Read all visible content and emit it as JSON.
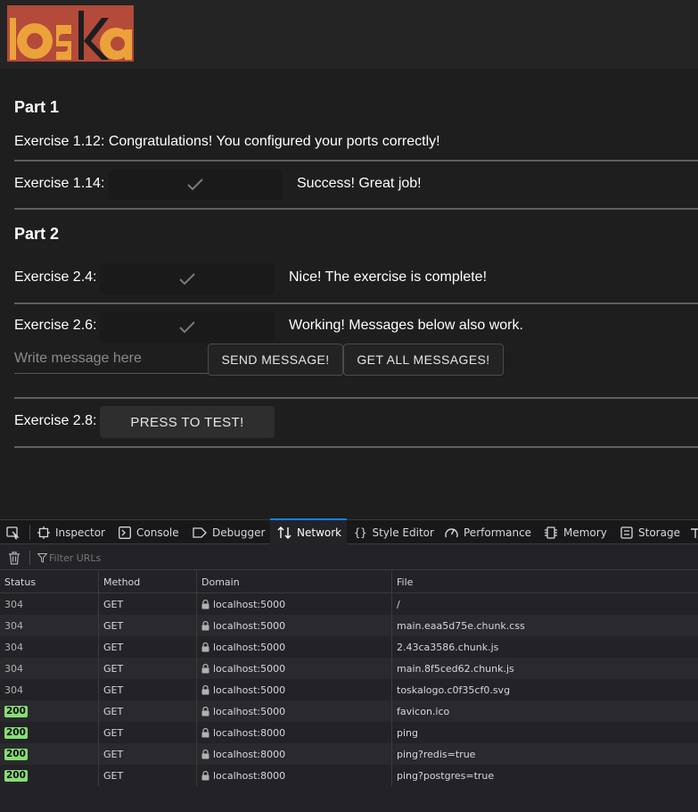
{
  "colors": {
    "app_bg": "#1e1e1e",
    "logo_red": "#b44a3a",
    "logo_orange": "#eca23a",
    "devtools_accent": "#0a84ff",
    "status_ok_bg": "#86de74"
  },
  "logo": {
    "text": "toska"
  },
  "part1": {
    "heading": "Part 1",
    "ex112": {
      "text": "Exercise 1.12: Congratulations! You configured your ports correctly!"
    },
    "ex114": {
      "label": "Exercise 1.14:",
      "message": "Success! Great job!",
      "button_icon": "checkmark-icon"
    }
  },
  "part2": {
    "heading": "Part 2",
    "ex24": {
      "label": "Exercise 2.4:",
      "message": "Nice! The exercise is complete!",
      "button_icon": "checkmark-icon"
    },
    "ex26": {
      "label": "Exercise 2.6:",
      "message": "Working! Messages below also work.",
      "button_icon": "checkmark-icon",
      "input_placeholder": "Write message here",
      "input_value": "",
      "send_button": "SEND MESSAGE!",
      "get_all_button": "GET ALL MESSAGES!"
    },
    "ex28": {
      "label": "Exercise 2.8:",
      "button": "PRESS TO TEST!"
    }
  },
  "devtools": {
    "tabs": [
      {
        "label": "Inspector",
        "icon": "inspector-icon"
      },
      {
        "label": "Console",
        "icon": "console-icon"
      },
      {
        "label": "Debugger",
        "icon": "debugger-icon"
      },
      {
        "label": "Network",
        "icon": "network-icon",
        "active": true
      },
      {
        "label": "Style Editor",
        "icon": "style-editor-icon"
      },
      {
        "label": "Performance",
        "icon": "performance-icon"
      },
      {
        "label": "Memory",
        "icon": "memory-icon"
      },
      {
        "label": "Storage",
        "icon": "storage-icon"
      }
    ],
    "filter_placeholder": "Filter URLs",
    "columns": [
      "Status",
      "Method",
      "Domain",
      "File"
    ],
    "requests": [
      {
        "status": "304",
        "method": "GET",
        "domain": "localhost:5000",
        "file": "/"
      },
      {
        "status": "304",
        "method": "GET",
        "domain": "localhost:5000",
        "file": "main.eaa5d75e.chunk.css"
      },
      {
        "status": "304",
        "method": "GET",
        "domain": "localhost:5000",
        "file": "2.43ca3586.chunk.js"
      },
      {
        "status": "304",
        "method": "GET",
        "domain": "localhost:5000",
        "file": "main.8f5ced62.chunk.js"
      },
      {
        "status": "304",
        "method": "GET",
        "domain": "localhost:5000",
        "file": "toskalogo.c0f35cf0.svg"
      },
      {
        "status": "200",
        "method": "GET",
        "domain": "localhost:5000",
        "file": "favicon.ico"
      },
      {
        "status": "200",
        "method": "GET",
        "domain": "localhost:8000",
        "file": "ping"
      },
      {
        "status": "200",
        "method": "GET",
        "domain": "localhost:8000",
        "file": "ping?redis=true"
      },
      {
        "status": "200",
        "method": "GET",
        "domain": "localhost:8000",
        "file": "ping?postgres=true"
      }
    ]
  }
}
